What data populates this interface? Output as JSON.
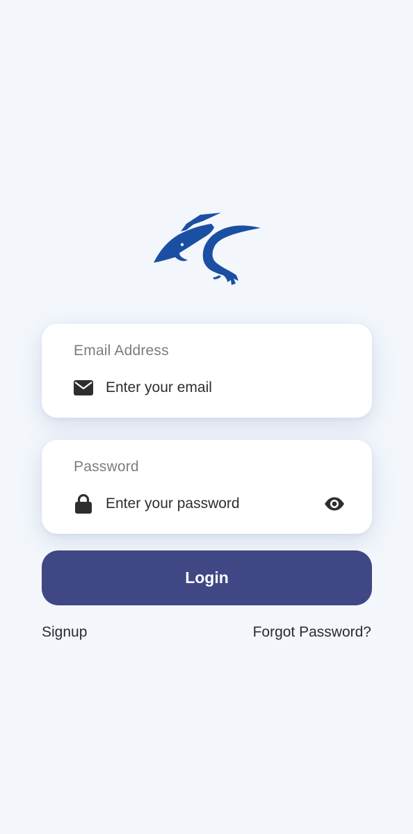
{
  "brand": {
    "logo_icon": "pterodactyl-logo",
    "logo_color": "#1a4fa3"
  },
  "email": {
    "label": "Email Address",
    "icon": "envelope-icon",
    "value": "",
    "placeholder": "Enter your email"
  },
  "password": {
    "label": "Password",
    "icon": "lock-icon",
    "value": "",
    "placeholder": "Enter your password",
    "toggle_icon": "eye-icon"
  },
  "actions": {
    "login_label": "Login",
    "signup_label": "Signup",
    "forgot_label": "Forgot Password?"
  },
  "colors": {
    "background": "#f3f7fc",
    "card": "#ffffff",
    "primary_button": "#3f4784",
    "text": "#2e2e30",
    "label": "#7c7c80"
  }
}
